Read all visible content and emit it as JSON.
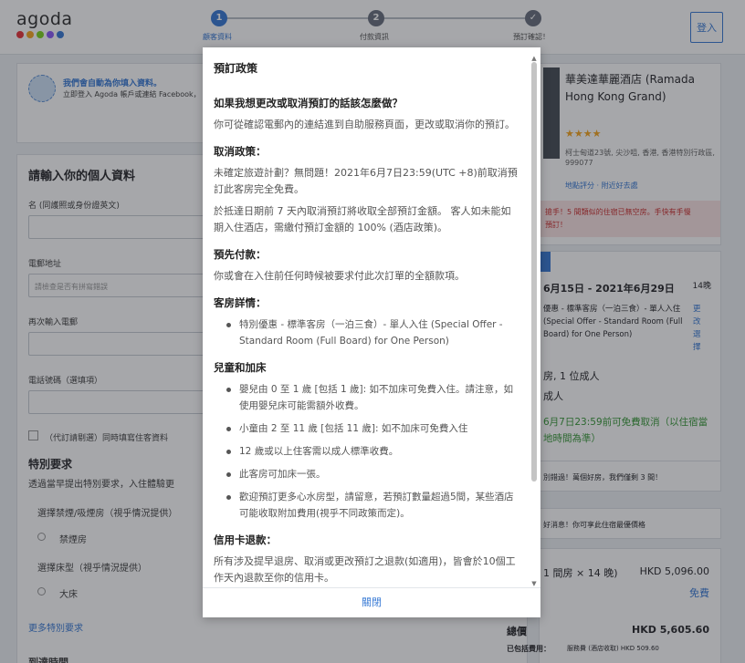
{
  "header": {
    "logo": "agoda",
    "logo_colors": [
      "#e8363d",
      "#f5a623",
      "#7ed321",
      "#8b5cf6",
      "#3a7bd5"
    ],
    "steps": [
      {
        "num": "1",
        "label": "顧客資料"
      },
      {
        "num": "2",
        "label": "付款資訊"
      },
      {
        "num": "✓",
        "label": "預訂確認！"
      }
    ],
    "login_label": "登入"
  },
  "form": {
    "autofill_title": "我們會自動為你填入資料。",
    "autofill_sub": "立即登入 Agoda 帳戶或連結 Facebook，",
    "section_title": "請輸入你的個人資料",
    "name_label": "名 (同護照或身份證英文)",
    "email_label": "電郵地址",
    "email_placeholder": "請檢查是否有拼寫錯誤",
    "reenter_label": "再次輸入電郵",
    "phone_label": "電話號碼（選填項）",
    "checkbox_label": "（代訂請剔選）同時填寫住客資料",
    "special_title": "特別要求",
    "special_desc": "透過當早提出特別要求，入住體驗更",
    "smoking_title": "選擇禁煙/吸煙房（視乎情況提供）",
    "smoking_option": "禁煙房",
    "bed_title": "選擇床型（視乎情況提供）",
    "bed_option": "大床",
    "more_requests": "更多特別要求",
    "arrival_title": "到達時間"
  },
  "hotel": {
    "name": "華美達華麗酒店 (Ramada Hong Kong Grand)",
    "address": "柯士甸道23號, 尖沙咀, 香港, 香港特別行政區, 999077",
    "map_link": "地點評分 · 附近好去處",
    "promo": "搶手！5 間類似的住宿已無空房。手快有手慢",
    "promo2": "預訂！",
    "dates": "6月15日 - 2021年6月29日",
    "nights": "14晚",
    "room": "優惠 - 標準客房（一泊三食）- 單人入住 (Special Offer - Standard Room (Full Board) for One Person)",
    "change_link": "更改選擇",
    "guests": "房, 1 位成人",
    "adults": "成人",
    "free_cancel": "6月7日23:59前可免費取消（以住宿當地時間為準）",
    "tip": "別錯過！萬個好房，我們僅剩 3 間！",
    "note": "好消息！你可享此住宿最優價格",
    "room_price_label": "1 間房 × 14 晚)",
    "room_price": "HKD 5,096.00",
    "free_label": "免費",
    "total_label": "總價",
    "total": "HKD 5,605.60",
    "included_label": "已包括費用：",
    "included_detail": "服務費 (酒店收取) HKD 509.60"
  },
  "modal": {
    "title": "預訂政策",
    "sections": [
      {
        "heading": "如果我想更改或取消預訂的話該怎麼做？",
        "paras": [
          "你可從確認電郵內的連結進到自助服務頁面，更改或取消你的預訂。"
        ]
      },
      {
        "heading": "取消政策：",
        "paras": [
          "未確定旅遊計劃？無問題！2021年6月7日23:59(UTC +8)前取消預訂此客房完全免費。",
          "於抵達日期前 7 天內取消預訂將收取全部預訂金額。 客人如未能如期入住酒店，需繳付預訂金額的 100% (酒店政策)。"
        ]
      },
      {
        "heading": "預先付款：",
        "paras": [
          "你或會在入住前任何時候被要求付此次訂單的全額款項。"
        ]
      },
      {
        "heading": "客房詳情：",
        "bullets": [
          "特別優惠 - 標準客房（一泊三食）- 單人入住 (Special Offer - Standard Room (Full Board) for One Person)"
        ]
      },
      {
        "heading": "兒童和加床",
        "bullets": [
          "嬰兒由 0 至 1 歲 [包括 1 歲]: 如不加床可免費入住。請注意，如使用嬰兒床可能需額外收費。",
          "小童由 2 至 11 歲 [包括 11 歲]: 如不加床可免費入住",
          "12 歲或以上住客需以成人標準收費。",
          "此客房可加床一張。",
          "歡迎預訂更多心水房型，請留意，若預訂數量超過5間，某些酒店可能收取附加費用(視乎不同政策而定)。"
        ]
      },
      {
        "heading": "信用卡退款：",
        "paras": [
          "所有涉及提早退房、取消或更改預訂之退款(如適用)，皆會於10個工作天內退款至你的信用卡。"
        ]
      }
    ],
    "close_label": "關閉"
  }
}
